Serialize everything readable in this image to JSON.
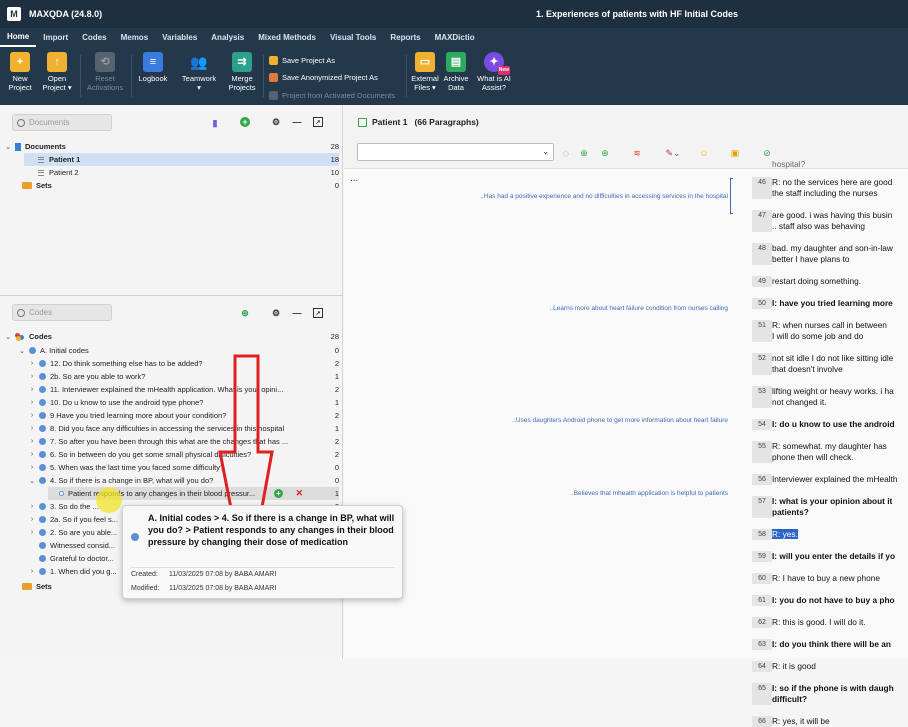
{
  "titlebar": {
    "app_title": "MAXQDA (24.8.0)",
    "document_title": "1. Experiences of patients with HF Initial Codes"
  },
  "menu": {
    "tabs": [
      "Home",
      "Import",
      "Codes",
      "Memos",
      "Variables",
      "Analysis",
      "Mixed Methods",
      "Visual Tools",
      "Reports",
      "MAXDictio"
    ],
    "active": "Home"
  },
  "ribbon": {
    "new_project": "New\nProject",
    "open_project": "Open\nProject ▾",
    "reset_activations": "Reset\nActivations",
    "logbook": "Logbook",
    "teamwork": "Teamwork\n▾",
    "merge_projects": "Merge\nProjects",
    "save_project_as": "Save Project As",
    "save_anonymized": "Save Anonymized Project As",
    "project_from_activated": "Project from Activated Documents",
    "external_files": "External\nFiles ▾",
    "archive_data": "Archive\nData",
    "ai_assist": "What is AI\nAssist?",
    "new_badge": "New"
  },
  "documents_pane": {
    "search_placeholder": "Documents",
    "root": {
      "label": "Documents",
      "count": "28"
    },
    "items": [
      {
        "label": "Patient 1",
        "count": "18"
      },
      {
        "label": "Patient 2",
        "count": "10"
      }
    ],
    "sets": {
      "label": "Sets",
      "count": "0"
    }
  },
  "codes_pane": {
    "search_placeholder": "Codes",
    "root": {
      "label": "Codes",
      "count": "28"
    },
    "group": {
      "label": "A. Initial codes",
      "count": "0"
    },
    "items": [
      {
        "label": "12. Do think something else has to be added?",
        "count": "2"
      },
      {
        "label": "2b. So are you able to work?",
        "count": "1"
      },
      {
        "label": "11. Interviewer explained the mHealth application. What is your opini...",
        "count": "2"
      },
      {
        "label": "10. Do u know to use the android type phone?",
        "count": "1"
      },
      {
        "label": "9 Have you tried learning more about your condition?",
        "count": "2"
      },
      {
        "label": "8. Did you face any difficulties in accessing the services in this hospital",
        "count": "1"
      },
      {
        "label": "7. So after you have been through this what are the changes that has ...",
        "count": "2"
      },
      {
        "label": "6. So in between do you get some small physical difficulties?",
        "count": "2"
      },
      {
        "label": "5.  When was the last time you faced some difficulty?",
        "count": "0"
      },
      {
        "label": "4. So if there is a change in BP, what will you do?",
        "count": "0"
      },
      {
        "label": "Patient responds to any changes in their blood pressur...",
        "count": "1"
      },
      {
        "label": "3. So do the ...",
        "count": "2"
      },
      {
        "label": "2a. So if you feel s...",
        "count": "2"
      },
      {
        "label": "2. So are you able...",
        "count": "2"
      },
      {
        "label": "Witnessed consid...",
        "count": ""
      },
      {
        "label": "Grateful to doctor...",
        "count": ""
      },
      {
        "label": "1. When did you g...",
        "count": ""
      }
    ],
    "sets": {
      "label": "Sets",
      "count": ""
    }
  },
  "popup": {
    "title": "A. Initial codes > 4. So if there is a change in BP, what will you do?  > Patient responds to any changes in their blood pressure by changing their dose of medication",
    "created_label": "Created:",
    "created_value": "11/03/2025 07:08 by BABA AMARI",
    "modified_label": "Modified:",
    "modified_value": "11/03/2025 07:08 by BABA AMARI"
  },
  "document_browser": {
    "title": "Patient 1   (66 Paragraphs)",
    "more": "...",
    "top_fragment": "hospital?",
    "memos": [
      "..Has had a positive experience and no difficulties in accessing services in the hospital",
      "..Learns more about heart failure condition from nurses calling",
      "..Uses daughters Android phone to get more information about heart failure",
      "..Believes that mhealth application is helpful to patients"
    ],
    "paragraphs": [
      {
        "num": "46",
        "lines": [
          "R: no the services here are good",
          "the staff including the nurses"
        ],
        "bold": false
      },
      {
        "num": "47",
        "lines": [
          "are good. i was having this busin",
          ".. staff also was behaving"
        ],
        "bold": false
      },
      {
        "num": "48",
        "lines": [
          "bad. my daughter and son-in-law",
          "better I have plans to"
        ],
        "bold": false
      },
      {
        "num": "49",
        "lines": [
          "restart doing something."
        ],
        "bold": false
      },
      {
        "num": "50",
        "lines": [
          "I: have you tried learning more"
        ],
        "bold": true
      },
      {
        "num": "51",
        "lines": [
          "R: when nurses call in between",
          "I will do some job and do"
        ],
        "bold": false
      },
      {
        "num": "52",
        "lines": [
          "not sit idle I do not like sitting idle",
          "that doesn't involve"
        ],
        "bold": false
      },
      {
        "num": "53",
        "lines": [
          "lifting weight or heavy works. i ha",
          "not changed it."
        ],
        "bold": false
      },
      {
        "num": "54",
        "lines": [
          "I: do u know to use the android"
        ],
        "bold": true
      },
      {
        "num": "55",
        "lines": [
          "R: somewhat. my daughter has",
          "phone then will check."
        ],
        "bold": false
      },
      {
        "num": "56",
        "lines": [
          "Interviewer explained the mHealth"
        ],
        "bold": false
      },
      {
        "num": "57",
        "lines": [
          "I: what is your opinion about it",
          "patients?"
        ],
        "bold": true
      },
      {
        "num": "58",
        "lines": [
          "R: yes."
        ],
        "bold": false
      },
      {
        "num": "59",
        "lines": [
          "I: will you enter the details if yo"
        ],
        "bold": true
      },
      {
        "num": "60",
        "lines": [
          "R: I have to buy a new phone"
        ],
        "bold": false
      },
      {
        "num": "61",
        "lines": [
          "I: you do not have to buy a pho"
        ],
        "bold": true
      },
      {
        "num": "62",
        "lines": [
          "R: this is good. I will do it."
        ],
        "bold": false
      },
      {
        "num": "63",
        "lines": [
          "I: do you think there will be an"
        ],
        "bold": true
      },
      {
        "num": "64",
        "lines": [
          "R: it is good"
        ],
        "bold": false
      },
      {
        "num": "65",
        "lines": [
          "I: so if the phone is with daugh",
          "difficult?"
        ],
        "bold": true
      },
      {
        "num": "66",
        "lines": [
          "R: yes, it will be"
        ],
        "bold": false
      }
    ]
  },
  "colors": {
    "titlebar": "#1e2f3f",
    "ribbon": "#24384b",
    "selected_row": "#cfe0f5",
    "annotation_arrow": "#e02020",
    "selection": "#2b64c8"
  }
}
